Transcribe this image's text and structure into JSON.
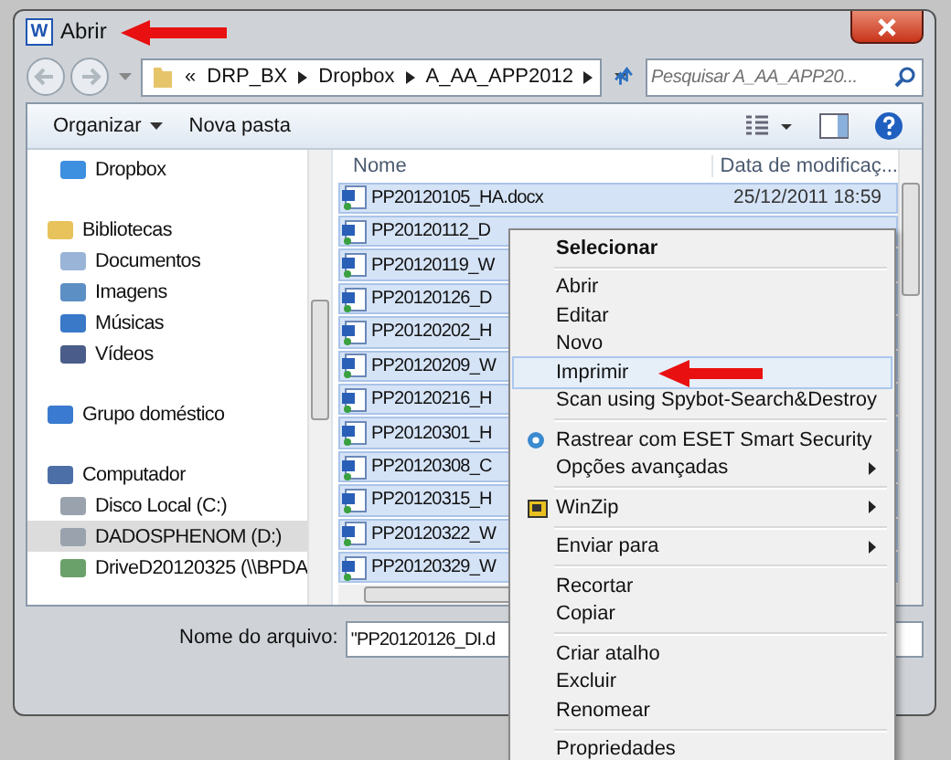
{
  "window": {
    "app_icon": "W",
    "title": "Abrir"
  },
  "address": {
    "crumbs": [
      "«",
      "DRP_BX",
      "Dropbox",
      "A_AA_APP2012"
    ]
  },
  "search": {
    "placeholder": "Pesquisar A_AA_APP20..."
  },
  "toolbar": {
    "buttons": [
      {
        "label": "Organizar",
        "dropdown": true
      },
      {
        "label": "Nova pasta",
        "dropdown": false
      }
    ]
  },
  "sidebar": {
    "items": [
      {
        "label": "Dropbox",
        "selected": false
      },
      {
        "label": "Bibliotecas",
        "selected": false,
        "children": [
          {
            "label": "Documentos",
            "selected": false
          },
          {
            "label": "Imagens",
            "selected": false
          },
          {
            "label": "Músicas",
            "selected": false
          },
          {
            "label": "Vídeos",
            "selected": false
          }
        ]
      },
      {
        "label": "Grupo doméstico",
        "selected": false
      },
      {
        "label": "Computador",
        "selected": false,
        "children": [
          {
            "label": "Disco Local (C:)",
            "selected": false
          },
          {
            "label": "DADOSPHENOM (D:)",
            "selected": true
          },
          {
            "label": "DriveD20120325 (\\\\BPDA",
            "selected": false
          }
        ]
      }
    ]
  },
  "file_list": {
    "columns": [
      "Nome",
      "Data de modificaç..."
    ],
    "rows": [
      {
        "name": "PP20120105_HA.docx",
        "date": "25/12/2011 18:59",
        "selected": true
      },
      {
        "name": "PP20120112_D",
        "selected": true
      },
      {
        "name": "PP20120119_W",
        "selected": true
      },
      {
        "name": "PP20120126_D",
        "selected": true
      },
      {
        "name": "PP20120202_H",
        "selected": true
      },
      {
        "name": "PP20120209_W",
        "selected": true
      },
      {
        "name": "PP20120216_H",
        "selected": true
      },
      {
        "name": "PP20120301_H",
        "selected": true
      },
      {
        "name": "PP20120308_C",
        "selected": true
      },
      {
        "name": "PP20120315_H",
        "selected": true
      },
      {
        "name": "PP20120322_W",
        "selected": true
      },
      {
        "name": "PP20120329_W",
        "selected": true
      }
    ]
  },
  "filename": {
    "label": "Nome do arquivo:",
    "value": "\"PP20120126_DI.d"
  },
  "context_menu": {
    "items": [
      {
        "kind": "item",
        "label": "Selecionar",
        "bold": true,
        "selected": false,
        "submenu": false
      },
      {
        "kind": "separator"
      },
      {
        "kind": "item",
        "label": "Abrir",
        "bold": false,
        "selected": false,
        "submenu": false
      },
      {
        "kind": "item",
        "label": "Editar",
        "bold": false,
        "selected": false,
        "submenu": false
      },
      {
        "kind": "item",
        "label": "Novo",
        "bold": false,
        "selected": false,
        "submenu": false
      },
      {
        "kind": "item",
        "label": "Imprimir",
        "bold": false,
        "selected": true,
        "submenu": false
      },
      {
        "kind": "item",
        "label": "Scan using Spybot-Search&Destroy",
        "bold": false,
        "selected": false,
        "submenu": false
      },
      {
        "kind": "separator"
      },
      {
        "kind": "eye_item",
        "label": "Rastrear com ESET Smart Security",
        "bold": false,
        "selected": false,
        "submenu": false
      },
      {
        "kind": "item",
        "label": "Opções avançadas",
        "bold": false,
        "selected": false,
        "submenu": true
      },
      {
        "kind": "separator"
      },
      {
        "kind": "zip_item",
        "label": "WinZip",
        "bold": false,
        "selected": false,
        "submenu": true
      },
      {
        "kind": "separator"
      },
      {
        "kind": "item",
        "label": "Enviar para",
        "bold": false,
        "selected": false,
        "submenu": true
      },
      {
        "kind": "separator"
      },
      {
        "kind": "item",
        "label": "Recortar",
        "bold": false,
        "selected": false,
        "submenu": false
      },
      {
        "kind": "item",
        "label": "Copiar",
        "bold": false,
        "selected": false,
        "submenu": false
      },
      {
        "kind": "separator"
      },
      {
        "kind": "item",
        "label": "Criar atalho",
        "bold": false,
        "selected": false,
        "submenu": false
      },
      {
        "kind": "item",
        "label": "Excluir",
        "bold": false,
        "selected": false,
        "submenu": false
      },
      {
        "kind": "item",
        "label": "Renomear",
        "bold": false,
        "selected": false,
        "submenu": false
      },
      {
        "kind": "separator"
      },
      {
        "kind": "item",
        "label": "Propriedades",
        "bold": false,
        "selected": false,
        "submenu": false
      }
    ]
  }
}
